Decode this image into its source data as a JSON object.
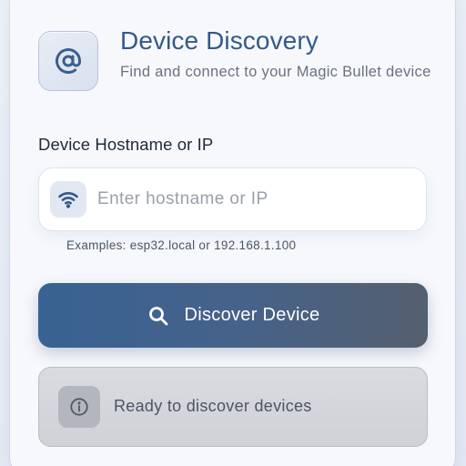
{
  "header": {
    "icon": "at-sign-icon",
    "title": "Device Discovery",
    "subtitle": "Find and connect to your Magic Bullet device"
  },
  "hostname_field": {
    "label": "Device Hostname or IP",
    "icon": "wifi-icon",
    "value": "",
    "placeholder": "Enter hostname or IP",
    "hint": "Examples: esp32.local or 192.168.1.100"
  },
  "discover_button": {
    "icon": "search-icon",
    "label": "Discover Device"
  },
  "status": {
    "icon": "info-icon",
    "text": "Ready to discover devices"
  },
  "colors": {
    "accent": "#34598a",
    "button_start": "#386292",
    "button_end": "#55606f",
    "status_bg": "#d4d6da"
  }
}
